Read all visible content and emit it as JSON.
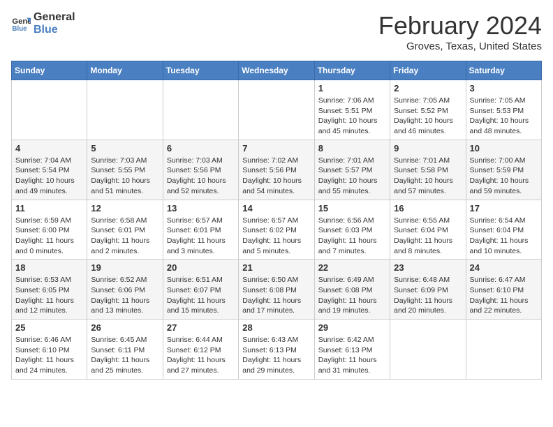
{
  "header": {
    "logo_line1": "General",
    "logo_line2": "Blue",
    "month": "February 2024",
    "location": "Groves, Texas, United States"
  },
  "days_of_week": [
    "Sunday",
    "Monday",
    "Tuesday",
    "Wednesday",
    "Thursday",
    "Friday",
    "Saturday"
  ],
  "weeks": [
    [
      {
        "day": "",
        "info": ""
      },
      {
        "day": "",
        "info": ""
      },
      {
        "day": "",
        "info": ""
      },
      {
        "day": "",
        "info": ""
      },
      {
        "day": "1",
        "info": "Sunrise: 7:06 AM\nSunset: 5:51 PM\nDaylight: 10 hours and 45 minutes."
      },
      {
        "day": "2",
        "info": "Sunrise: 7:05 AM\nSunset: 5:52 PM\nDaylight: 10 hours and 46 minutes."
      },
      {
        "day": "3",
        "info": "Sunrise: 7:05 AM\nSunset: 5:53 PM\nDaylight: 10 hours and 48 minutes."
      }
    ],
    [
      {
        "day": "4",
        "info": "Sunrise: 7:04 AM\nSunset: 5:54 PM\nDaylight: 10 hours and 49 minutes."
      },
      {
        "day": "5",
        "info": "Sunrise: 7:03 AM\nSunset: 5:55 PM\nDaylight: 10 hours and 51 minutes."
      },
      {
        "day": "6",
        "info": "Sunrise: 7:03 AM\nSunset: 5:56 PM\nDaylight: 10 hours and 52 minutes."
      },
      {
        "day": "7",
        "info": "Sunrise: 7:02 AM\nSunset: 5:56 PM\nDaylight: 10 hours and 54 minutes."
      },
      {
        "day": "8",
        "info": "Sunrise: 7:01 AM\nSunset: 5:57 PM\nDaylight: 10 hours and 55 minutes."
      },
      {
        "day": "9",
        "info": "Sunrise: 7:01 AM\nSunset: 5:58 PM\nDaylight: 10 hours and 57 minutes."
      },
      {
        "day": "10",
        "info": "Sunrise: 7:00 AM\nSunset: 5:59 PM\nDaylight: 10 hours and 59 minutes."
      }
    ],
    [
      {
        "day": "11",
        "info": "Sunrise: 6:59 AM\nSunset: 6:00 PM\nDaylight: 11 hours and 0 minutes."
      },
      {
        "day": "12",
        "info": "Sunrise: 6:58 AM\nSunset: 6:01 PM\nDaylight: 11 hours and 2 minutes."
      },
      {
        "day": "13",
        "info": "Sunrise: 6:57 AM\nSunset: 6:01 PM\nDaylight: 11 hours and 3 minutes."
      },
      {
        "day": "14",
        "info": "Sunrise: 6:57 AM\nSunset: 6:02 PM\nDaylight: 11 hours and 5 minutes."
      },
      {
        "day": "15",
        "info": "Sunrise: 6:56 AM\nSunset: 6:03 PM\nDaylight: 11 hours and 7 minutes."
      },
      {
        "day": "16",
        "info": "Sunrise: 6:55 AM\nSunset: 6:04 PM\nDaylight: 11 hours and 8 minutes."
      },
      {
        "day": "17",
        "info": "Sunrise: 6:54 AM\nSunset: 6:04 PM\nDaylight: 11 hours and 10 minutes."
      }
    ],
    [
      {
        "day": "18",
        "info": "Sunrise: 6:53 AM\nSunset: 6:05 PM\nDaylight: 11 hours and 12 minutes."
      },
      {
        "day": "19",
        "info": "Sunrise: 6:52 AM\nSunset: 6:06 PM\nDaylight: 11 hours and 13 minutes."
      },
      {
        "day": "20",
        "info": "Sunrise: 6:51 AM\nSunset: 6:07 PM\nDaylight: 11 hours and 15 minutes."
      },
      {
        "day": "21",
        "info": "Sunrise: 6:50 AM\nSunset: 6:08 PM\nDaylight: 11 hours and 17 minutes."
      },
      {
        "day": "22",
        "info": "Sunrise: 6:49 AM\nSunset: 6:08 PM\nDaylight: 11 hours and 19 minutes."
      },
      {
        "day": "23",
        "info": "Sunrise: 6:48 AM\nSunset: 6:09 PM\nDaylight: 11 hours and 20 minutes."
      },
      {
        "day": "24",
        "info": "Sunrise: 6:47 AM\nSunset: 6:10 PM\nDaylight: 11 hours and 22 minutes."
      }
    ],
    [
      {
        "day": "25",
        "info": "Sunrise: 6:46 AM\nSunset: 6:10 PM\nDaylight: 11 hours and 24 minutes."
      },
      {
        "day": "26",
        "info": "Sunrise: 6:45 AM\nSunset: 6:11 PM\nDaylight: 11 hours and 25 minutes."
      },
      {
        "day": "27",
        "info": "Sunrise: 6:44 AM\nSunset: 6:12 PM\nDaylight: 11 hours and 27 minutes."
      },
      {
        "day": "28",
        "info": "Sunrise: 6:43 AM\nSunset: 6:13 PM\nDaylight: 11 hours and 29 minutes."
      },
      {
        "day": "29",
        "info": "Sunrise: 6:42 AM\nSunset: 6:13 PM\nDaylight: 11 hours and 31 minutes."
      },
      {
        "day": "",
        "info": ""
      },
      {
        "day": "",
        "info": ""
      }
    ]
  ]
}
